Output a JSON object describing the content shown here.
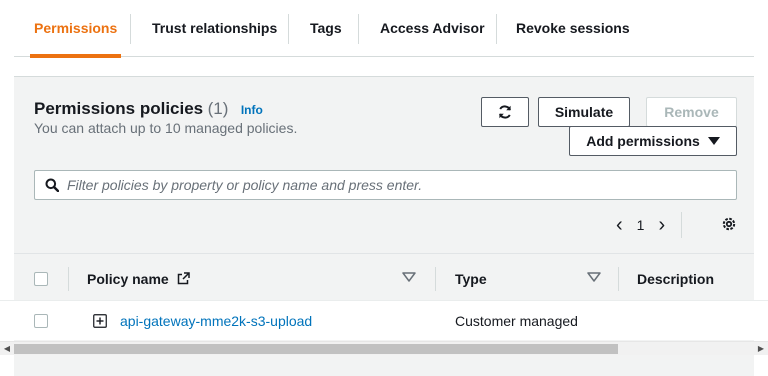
{
  "tabs": [
    {
      "label": "Permissions",
      "active": true
    },
    {
      "label": "Trust relationships",
      "active": false
    },
    {
      "label": "Tags",
      "active": false
    },
    {
      "label": "Access Advisor",
      "active": false
    },
    {
      "label": "Revoke sessions",
      "active": false
    }
  ],
  "policies": {
    "title": "Permissions policies",
    "count": "(1)",
    "info_label": "Info",
    "subtitle": "You can attach up to 10 managed policies.",
    "refresh_icon": "refresh-icon",
    "simulate_label": "Simulate",
    "remove_label": "Remove",
    "add_permissions_label": "Add permissions",
    "search_placeholder": "Filter policies by property or policy name and press enter.",
    "search_icon": "search-icon",
    "pagination": {
      "current_page": "1"
    },
    "settings_icon": "gear-icon"
  },
  "table": {
    "columns": {
      "policy_name": "Policy name",
      "type": "Type",
      "description": "Description"
    },
    "rows": [
      {
        "policy_name": "api-gateway-mme2k-s3-upload",
        "type": "Customer managed",
        "description": ""
      }
    ]
  },
  "colors": {
    "accent": "#ec7211",
    "link": "#0073bb",
    "text": "#16191f",
    "muted": "#687078"
  }
}
